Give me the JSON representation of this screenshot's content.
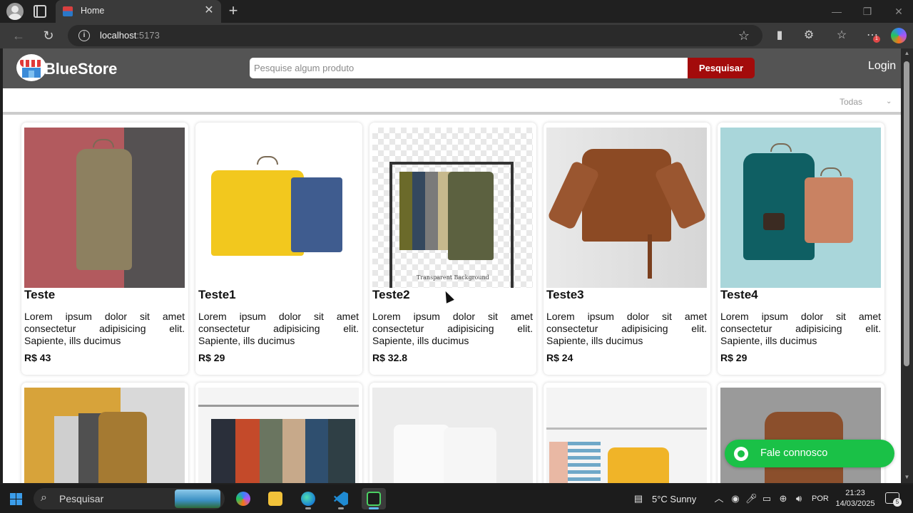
{
  "browser": {
    "tab_title": "Home",
    "url_host": "localhost",
    "url_port": ":5173",
    "notification_count": "1"
  },
  "site": {
    "logo_text": "BlueStore",
    "search_placeholder": "Pesquise algum produto",
    "search_button": "Pesquisar",
    "login": "Login",
    "category_selected": "Todas"
  },
  "products": [
    {
      "title": "Teste",
      "description": "Lorem ipsum dolor sit amet consectetur adipisicing elit. Sapiente, ills ducimus",
      "price": "R$ 43"
    },
    {
      "title": "Teste1",
      "description": "Lorem ipsum dolor sit amet consectetur adipisicing elit. Sapiente, ills ducimus",
      "price": "R$ 29"
    },
    {
      "title": "Teste2",
      "description": "Lorem ipsum dolor sit amet consectetur adipisicing elit. Sapiente, ills ducimus",
      "price": "R$ 32.8",
      "image_caption": "Transparent Background"
    },
    {
      "title": "Teste3",
      "description": "Lorem ipsum dolor sit amet consectetur adipisicing elit. Sapiente, ills ducimus",
      "price": "R$ 24"
    },
    {
      "title": "Teste4",
      "description": "Lorem ipsum dolor sit amet consectetur adipisicing elit. Sapiente, ills ducimus",
      "price": "R$ 29"
    }
  ],
  "whatsapp": {
    "label": "Fale connosco"
  },
  "taskbar": {
    "search_label": "Pesquisar",
    "weather": "5°C  Sunny",
    "language": "POR",
    "time": "21:23",
    "date": "14/03/2025",
    "notification_count": "5"
  },
  "colors": {
    "header_bg": "#545454",
    "search_button_bg": "#a30b0b",
    "whatsapp_green": "#1ac147"
  }
}
